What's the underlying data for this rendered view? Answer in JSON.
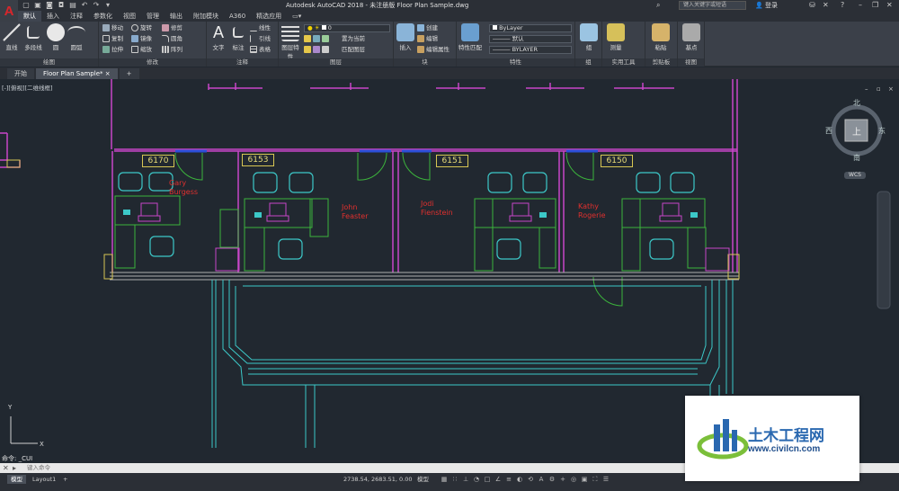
{
  "app": {
    "logo": "A",
    "window_title": "Autodesk AutoCAD 2018 - 未注册版    Floor Plan Sample.dwg",
    "search_placeholder": "键入关键字或短语",
    "login": "登录",
    "brand_red": "#d9262b"
  },
  "ribbon_tabs": [
    "默认",
    "插入",
    "注释",
    "参数化",
    "视图",
    "管理",
    "输出",
    "附加模块",
    "A360",
    "精选应用"
  ],
  "ribbon_groups": {
    "draw": {
      "label": "绘图",
      "line": "直线",
      "polyline": "多段线",
      "circle": "圆",
      "arc": "圆弧"
    },
    "modify": {
      "label": "修改",
      "move": "移动",
      "rotate": "旋转",
      "trim": "修剪",
      "copy": "复制",
      "mirror": "镜像",
      "fillet": "圆角",
      "stretch": "拉伸",
      "scale": "缩放",
      "array": "阵列"
    },
    "annotation": {
      "label": "注释",
      "text": "文字",
      "dimension": "标注",
      "linear": "线性",
      "leader": "引线",
      "table": "表格"
    },
    "layers": {
      "label": "图层",
      "layer_props": "图层特性",
      "current_layer": "0",
      "make_current": "置为当前",
      "match_layer": "匹配图层"
    },
    "block": {
      "label": "块",
      "insert": "插入",
      "create": "创建",
      "edit": "编辑",
      "edit_attr": "编辑属性"
    },
    "properties": {
      "label": "特性",
      "match": "特性匹配",
      "color": "ByLayer",
      "linetype": "默认",
      "lineweight": "BYLAYER"
    },
    "groups": {
      "label": "组",
      "group": "组"
    },
    "utilities": {
      "label": "实用工具",
      "measure": "测量"
    },
    "clipboard": {
      "label": "剪贴板",
      "paste": "粘贴"
    },
    "view": {
      "label": "视图",
      "base": "基点"
    }
  },
  "file_tabs": [
    "开始",
    "Floor Plan Sample*"
  ],
  "viewport_label": "[-][俯视][二维线框]",
  "viewcube": {
    "top": "北",
    "bottom": "南",
    "left": "西",
    "right": "东",
    "face": "上",
    "wcs": "WCS"
  },
  "rooms": [
    {
      "number": "6170",
      "name_line1": "Gary",
      "name_line2": "Burgess"
    },
    {
      "number": "6153",
      "name_line1": "John",
      "name_line2": "Feaster"
    },
    {
      "number": "6151",
      "name_line1": "Jodi",
      "name_line2": "Fienstein"
    },
    {
      "number": "6150",
      "name_line1": "Kathy",
      "name_line2": "Rogerie"
    }
  ],
  "ucs": {
    "x": "X",
    "y": "Y"
  },
  "command": {
    "history": "命令: _CUI",
    "placeholder": "键入命令"
  },
  "status": {
    "tabs": [
      "模型",
      "Layout1"
    ],
    "coords": "2738.54, 2683.51, 0.00",
    "model": "模型"
  },
  "watermark": {
    "name": "土木工程网",
    "url": "www.civilcn.com"
  },
  "colors": {
    "wall_magenta": "#c846c8",
    "cyan": "#3cc8c8",
    "green": "#3cb43c",
    "yellow_tag": "#d7c653",
    "red_text": "#e0302e"
  }
}
